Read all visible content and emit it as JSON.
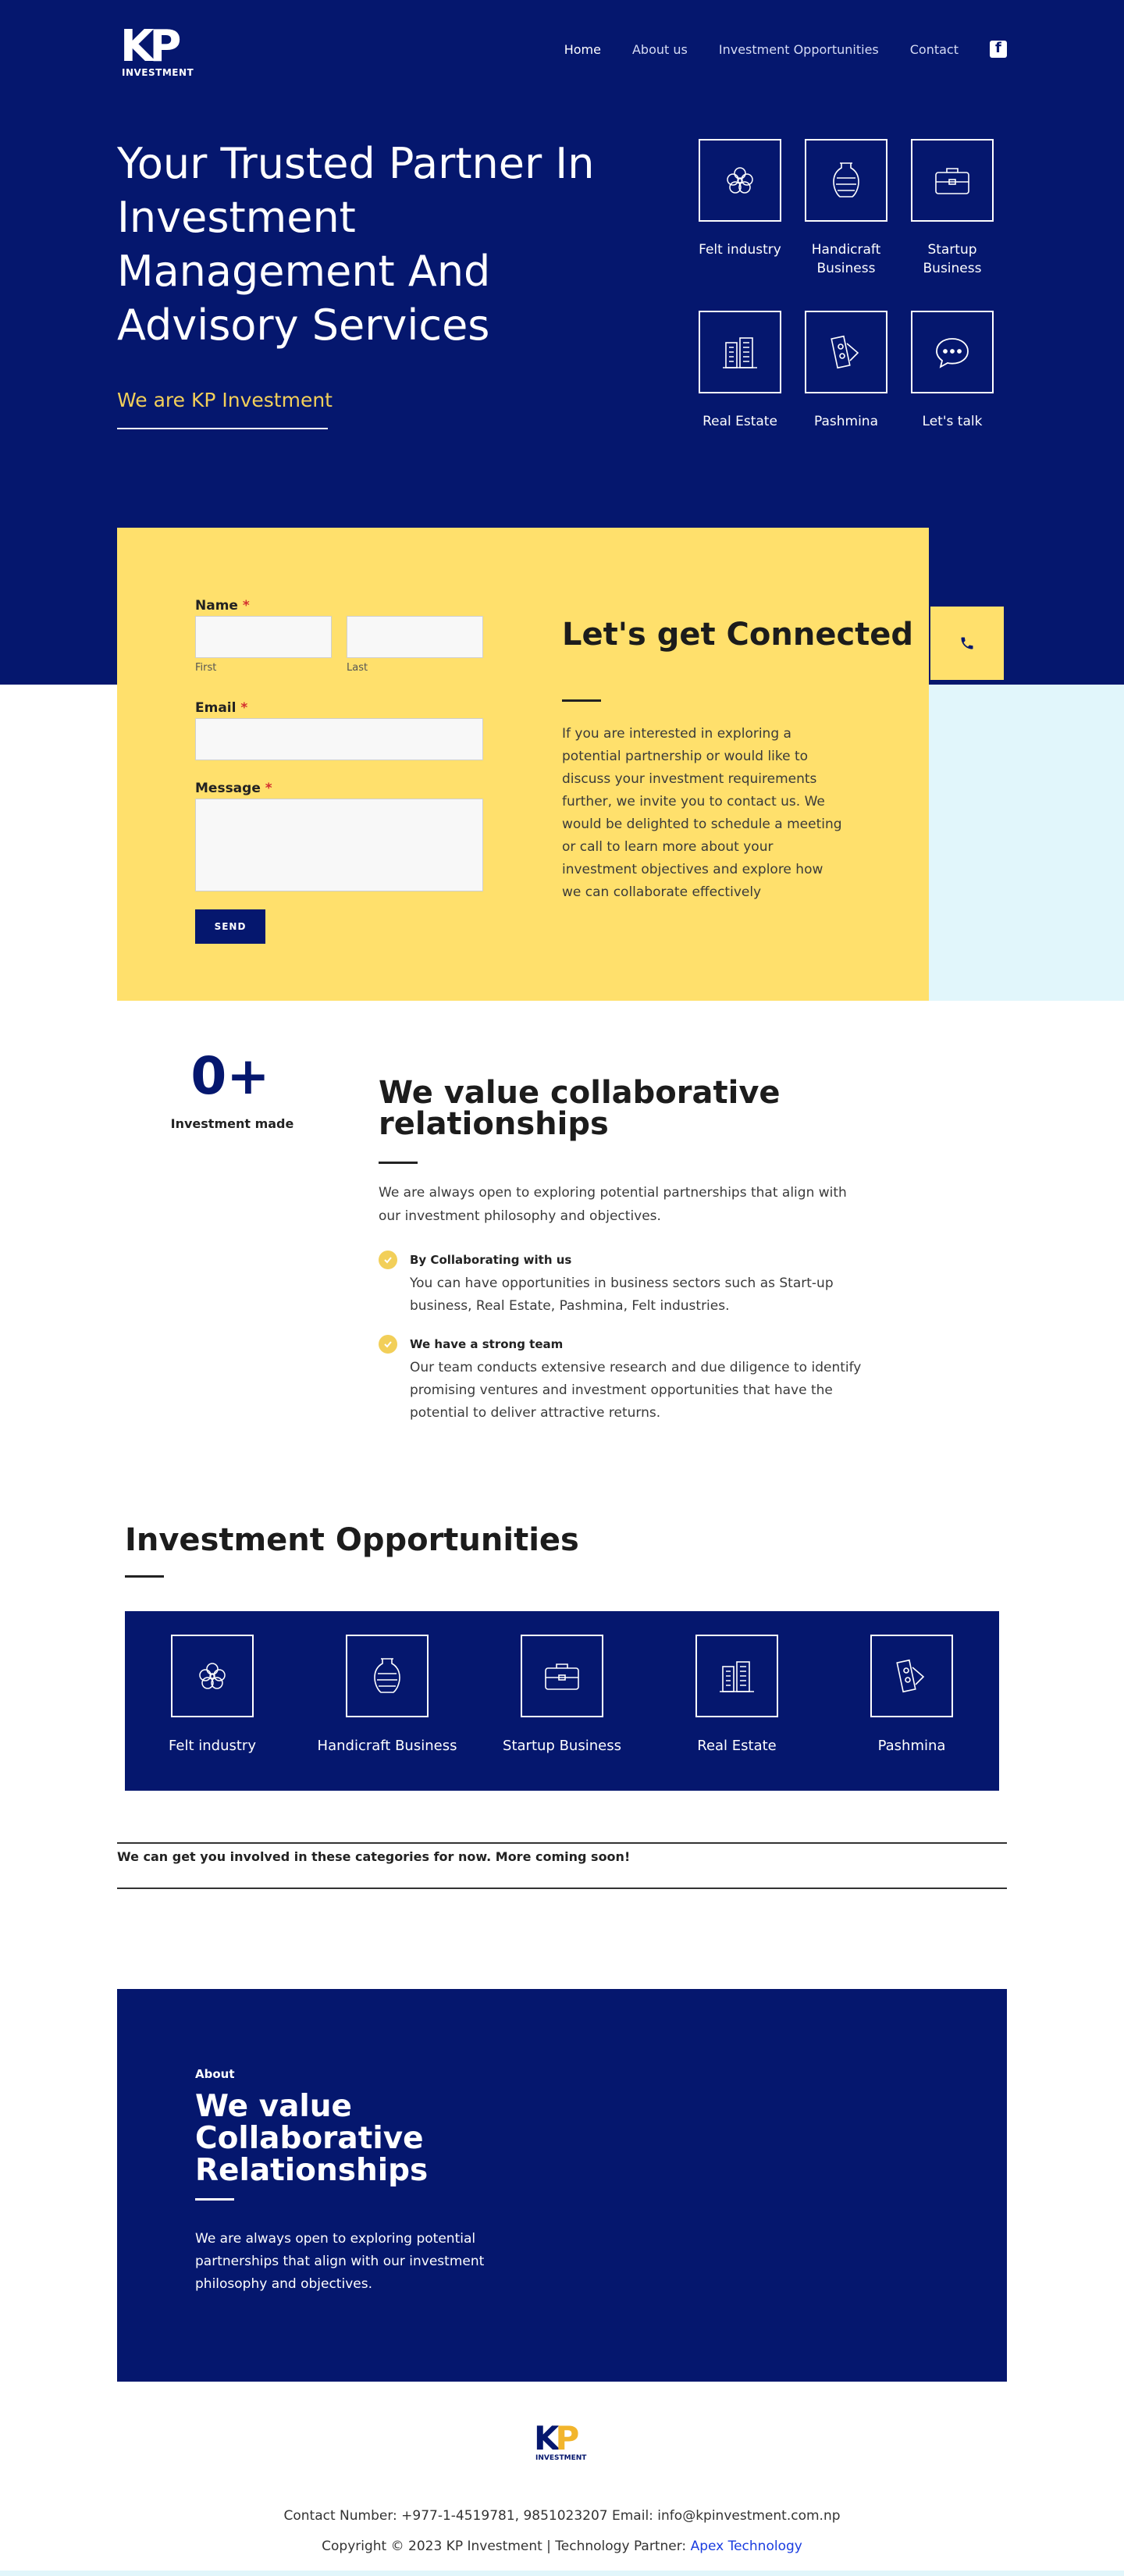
{
  "brand": {
    "logo_letters": "KP",
    "logo_sub": "INVESTMENT"
  },
  "nav": {
    "items": [
      {
        "label": "Home"
      },
      {
        "label": "About us"
      },
      {
        "label": "Investment Opportunities"
      },
      {
        "label": "Contact"
      }
    ],
    "social_icon": "facebook-icon"
  },
  "hero": {
    "title": "Your Trusted Partner In Investment Management And Advisory Services",
    "subtitle": "We are KP Investment",
    "cards": [
      {
        "label": "Felt industry",
        "icon": "felt-flower-icon"
      },
      {
        "label": "Handicraft Business",
        "icon": "vase-icon"
      },
      {
        "label": "Startup Business",
        "icon": "briefcase-icon"
      },
      {
        "label": "Real Estate",
        "icon": "buildings-icon"
      },
      {
        "label": "Pashmina",
        "icon": "pashmina-tag-icon"
      },
      {
        "label": "Let's talk",
        "icon": "chat-bubble-icon"
      }
    ]
  },
  "contact": {
    "name_label": "Name",
    "required_mark": "*",
    "first_hint": "First",
    "last_hint": "Last",
    "email_label": "Email",
    "message_label": "Message",
    "send_label": "SEND",
    "title": "Let's get Connected",
    "text": "If you are interested in exploring a potential partnership or would like to discuss your investment requirements further, we invite you to contact us. We would be delighted to schedule a meeting or call to learn more about your investment objectives and explore how we can collaborate effectively",
    "phone_icon": "phone-icon"
  },
  "stats": {
    "value": "0+",
    "label": "Investment made"
  },
  "collab": {
    "title": "We value collaborative relationships",
    "intro": "We are always open to exploring potential partnerships that align with our investment philosophy and objectives.",
    "features": [
      {
        "title": "By Collaborating with us",
        "text": "You can have opportunities in business sectors such as Start-up business, Real Estate, Pashmina, Felt industries."
      },
      {
        "title": "We have a strong team",
        "text": "Our team conducts extensive research and due diligence to identify promising ventures and investment opportunities that have the potential to deliver attractive returns."
      }
    ]
  },
  "opportunities": {
    "title": "Investment Opportunities",
    "items": [
      {
        "label": "Felt industry"
      },
      {
        "label": "Handicraft Business"
      },
      {
        "label": "Startup Business"
      },
      {
        "label": "Real Estate"
      },
      {
        "label": "Pashmina"
      }
    ],
    "note": "We can get you involved in these categories for now. More coming soon!"
  },
  "about": {
    "kicker": "About",
    "title": "We value Collaborative Relationships",
    "text": "We are always open to exploring potential partnerships that align with our investment philosophy and objectives."
  },
  "footer": {
    "logo_k": "K",
    "logo_p": "P",
    "logo_sub": "INVESTMENT",
    "contact": "Contact Number: +977-1-4519781, 9851023207 Email: info@kpinvestment.com.np",
    "copyright": "Copyright © 2023 KP Investment | Technology Partner:",
    "partner": "Apex Technology"
  },
  "colors": {
    "navy": "#05176e",
    "yellow": "#ffe06c",
    "gold": "#f2cf59",
    "light_blue": "#e1f6fb"
  }
}
